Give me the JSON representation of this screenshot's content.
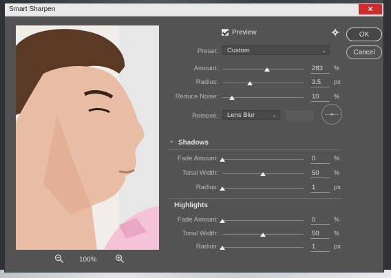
{
  "window": {
    "title": "Smart Sharpen",
    "close_label": "×"
  },
  "preview": {
    "zoom_level": "100%",
    "zoom_out_icon": "zoom-out-icon",
    "zoom_in_icon": "zoom-in-icon"
  },
  "header": {
    "preview_label": "Preview",
    "preview_checked": true,
    "gear_icon": "gear-icon"
  },
  "buttons": {
    "ok": "OK",
    "cancel": "Cancel"
  },
  "preset": {
    "label": "Preset:",
    "value": "Custom"
  },
  "main_controls": {
    "amount": {
      "label": "Amount:",
      "value": "283",
      "unit": "%",
      "slider_fraction": 0.5
    },
    "radius": {
      "label": "Radius:",
      "value": "3.5",
      "unit": "px",
      "slider_fraction": 0.3
    },
    "reduce_noise": {
      "label": "Reduce Noise:",
      "value": "10",
      "unit": "%",
      "slider_fraction": 0.1
    }
  },
  "remove": {
    "label": "Remove:",
    "value": "Lens Blur"
  },
  "shadows": {
    "title": "Shadows",
    "fade_amount": {
      "label": "Fade Amount:",
      "value": "0",
      "unit": "%",
      "slider_fraction": 0.0
    },
    "tonal_width": {
      "label": "Tonal Width:",
      "value": "50",
      "unit": "%",
      "slider_fraction": 0.5
    },
    "radius": {
      "label": "Radius:",
      "value": "1",
      "unit": "px",
      "slider_fraction": 0.0
    }
  },
  "highlights": {
    "title": "Highlights",
    "fade_amount": {
      "label": "Fade Amount:",
      "value": "0",
      "unit": "%",
      "slider_fraction": 0.0
    },
    "tonal_width": {
      "label": "Tonal Width:",
      "value": "50",
      "unit": "%",
      "slider_fraction": 0.5
    },
    "radius": {
      "label": "Radius:",
      "value": "1",
      "unit": "px",
      "slider_fraction": 0.0
    }
  }
}
